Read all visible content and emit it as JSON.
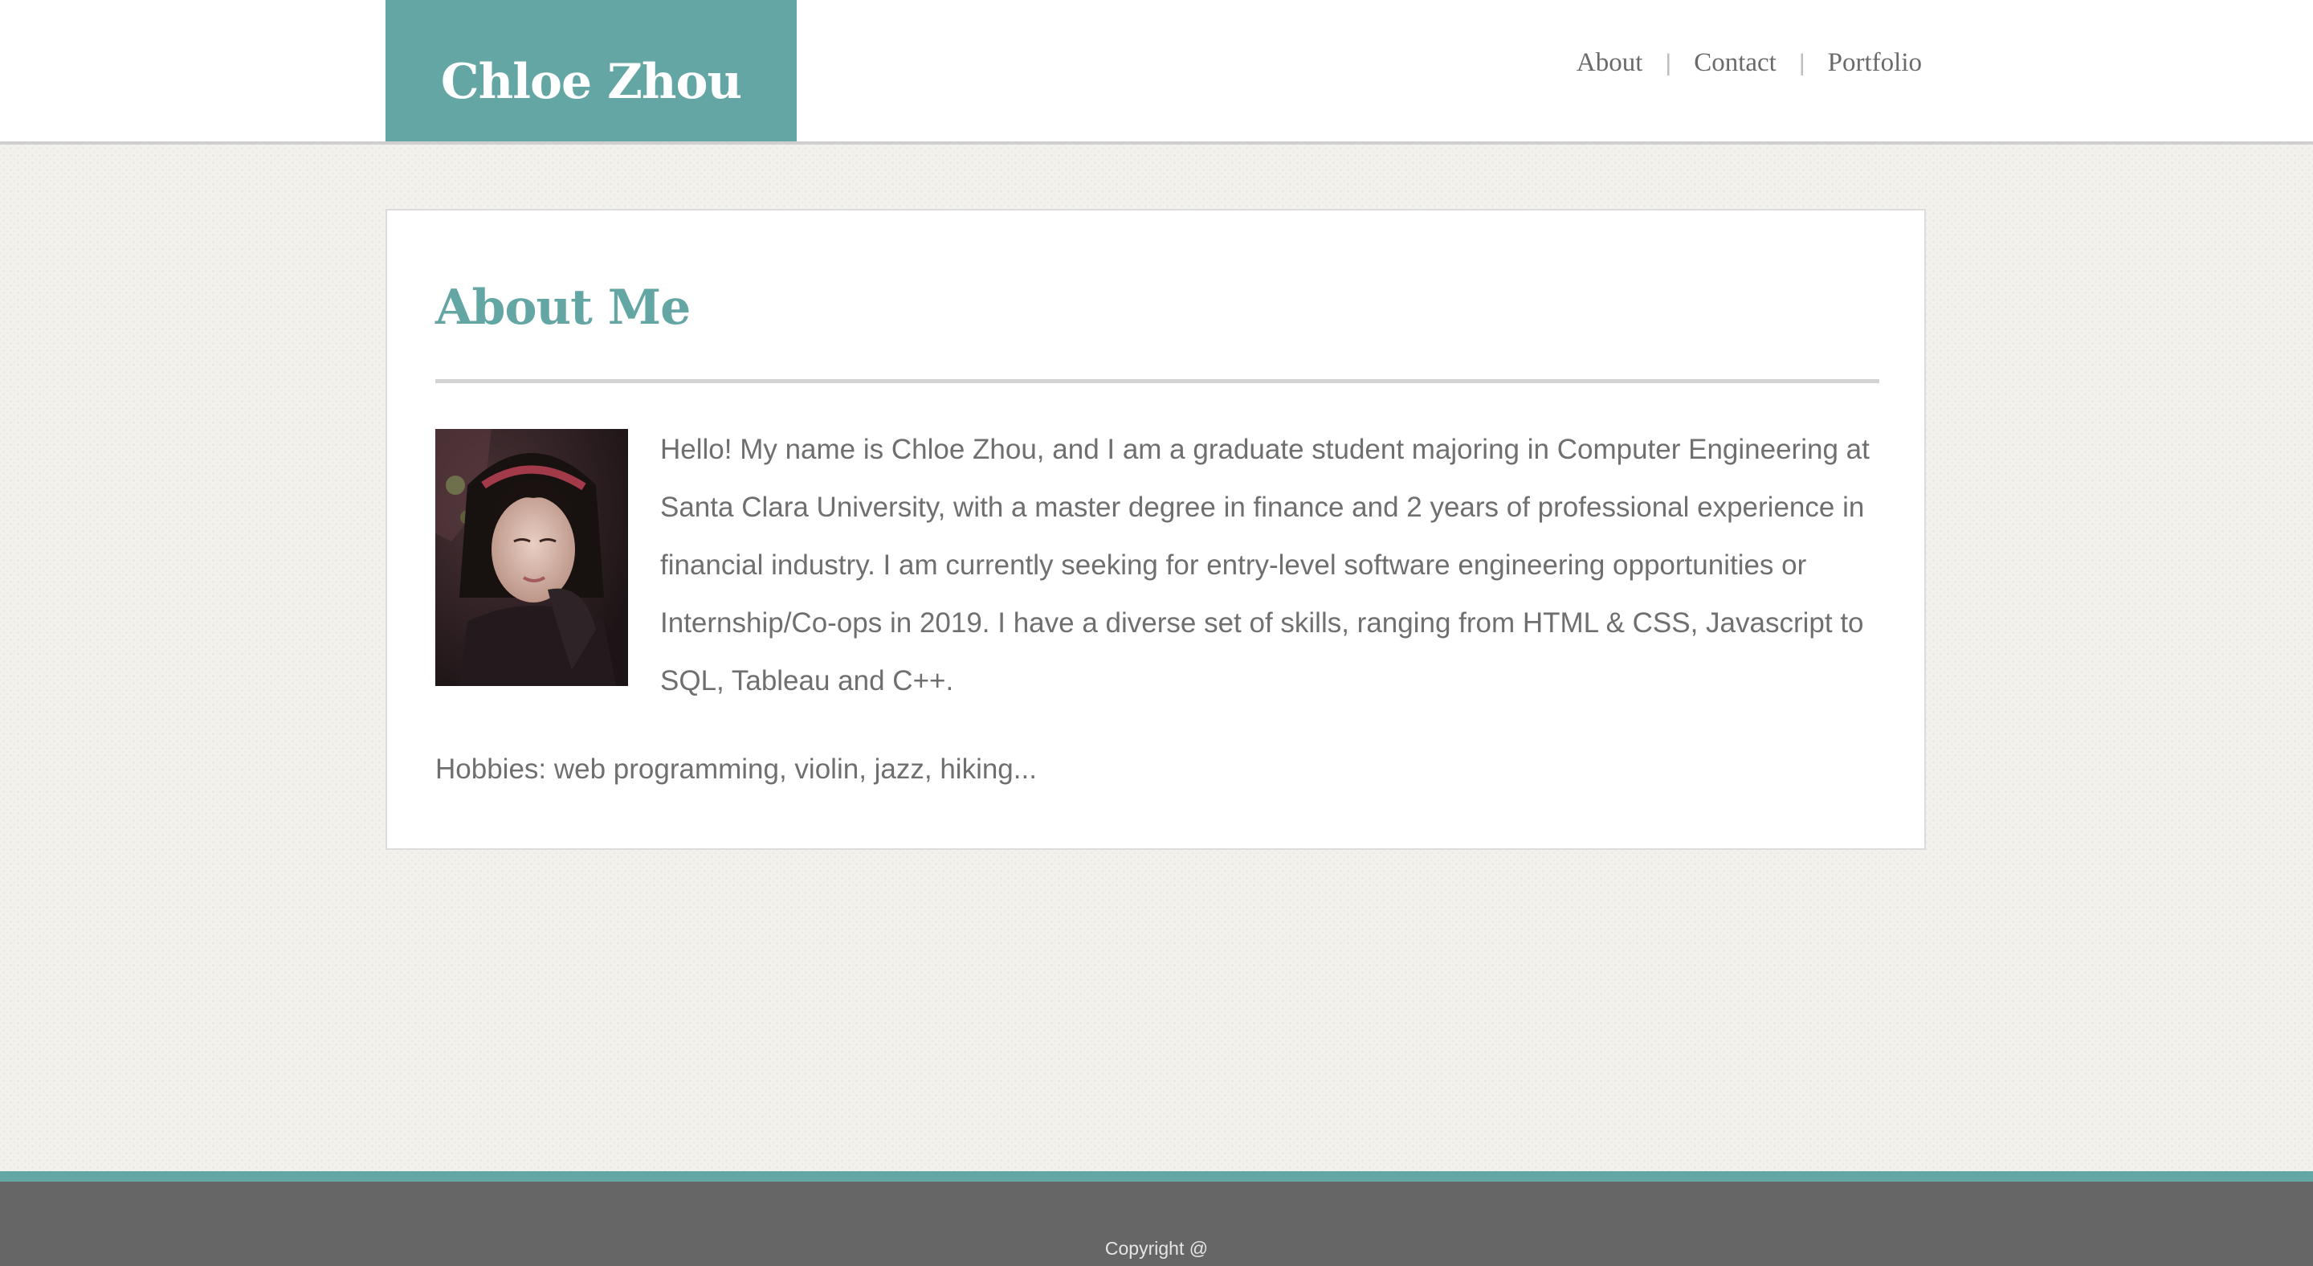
{
  "header": {
    "site_title": "Chloe Zhou",
    "nav": [
      {
        "label": "About"
      },
      {
        "label": "Contact"
      },
      {
        "label": "Portfolio"
      }
    ],
    "separator": "|"
  },
  "main": {
    "heading": "About Me",
    "profile_photo": "profile-photo",
    "bio": "Hello! My name is Chloe Zhou, and I am a graduate student majoring in Computer Engineering at Santa Clara University, with a master degree in finance and 2 years of professional experience in financial industry. I am currently seeking for entry-level software engineering opportunities or Internship/Co-ops in 2019. I have a diverse set of skills, ranging from HTML & CSS, Javascript to SQL, Tableau and C++.",
    "hobbies": "Hobbies: web programming, violin, jazz, hiking..."
  },
  "footer": {
    "copyright": "Copyright @"
  },
  "colors": {
    "accent": "#63a6a3",
    "footer_bg": "#666666",
    "text": "#6f6f6f"
  }
}
